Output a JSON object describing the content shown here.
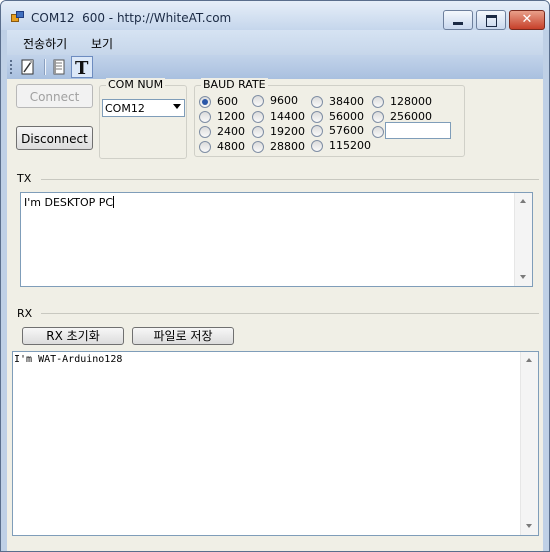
{
  "window": {
    "title": "COM12  600 - http://WhiteAT.com"
  },
  "menu": [
    {
      "label": "전송하기"
    },
    {
      "label": "보기"
    }
  ],
  "toolbar": {
    "icons": [
      "notepad-icon",
      "document-icon",
      "text-t-icon"
    ]
  },
  "buttons": {
    "connect": "Connect",
    "disconnect": "Disconnect"
  },
  "com": {
    "label": "COM NUM",
    "selected": "COM12"
  },
  "baud": {
    "label": "BAUD RATE",
    "options": [
      "600",
      "9600",
      "38400",
      "128000",
      "1200",
      "14400",
      "56000",
      "256000",
      "2400",
      "19200",
      "57600",
      "4800",
      "28800",
      "115200"
    ],
    "selected": "600",
    "custom_value": ""
  },
  "tx": {
    "label": "TX",
    "value": "I'm DESKTOP PC"
  },
  "rx": {
    "label": "RX",
    "reset_button": "RX 초기화",
    "save_button": "파일로 저장",
    "value": "I'm WAT-Arduino128"
  },
  "colors": {
    "titlebar": "#c5d6ec",
    "menubar": "#c6d6ea",
    "toolbar": "#a9c0df",
    "selected_radio": "#2a57a8"
  }
}
